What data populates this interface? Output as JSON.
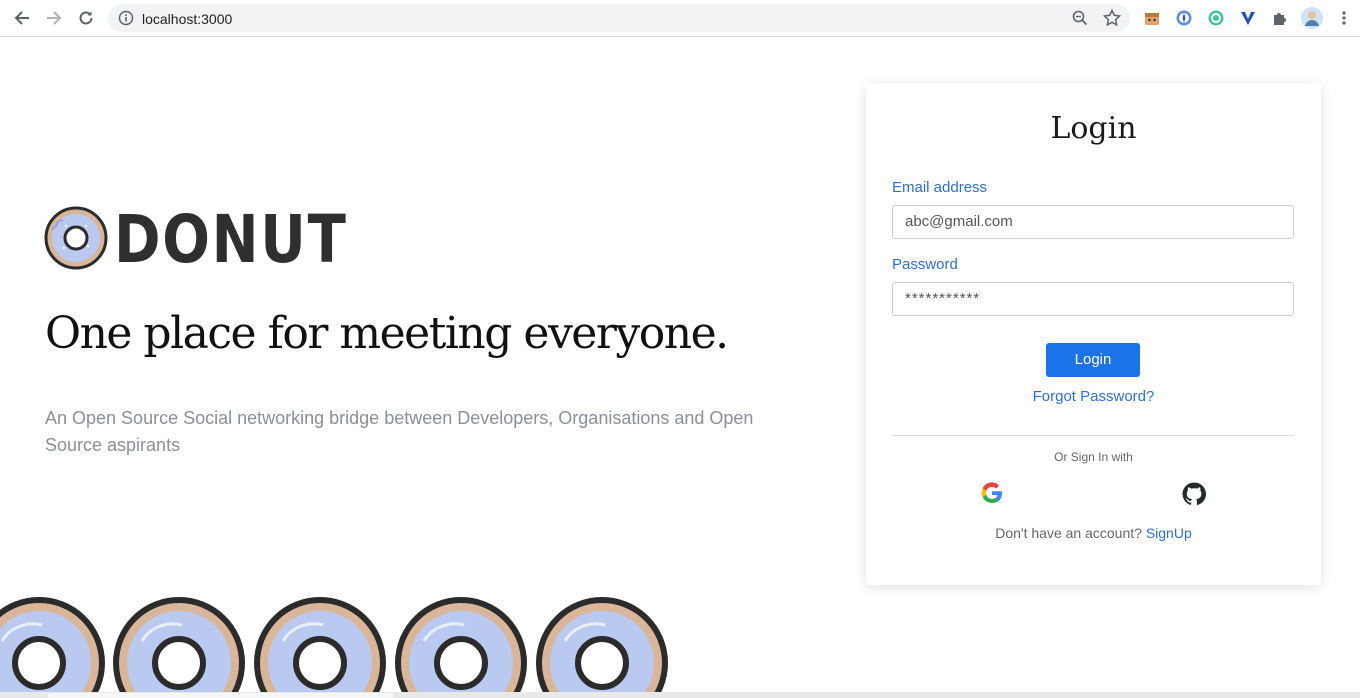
{
  "browser": {
    "url": "localhost:3000",
    "icons": [
      "back-arrow-icon",
      "forward-arrow-icon",
      "reload-icon",
      "info-icon",
      "zoom-icon",
      "star-icon",
      "extension-puzzle-icon",
      "more-vert-icon",
      "profile-avatar"
    ]
  },
  "hero": {
    "brand": "DONUT",
    "headline": "One place for meeting everyone.",
    "tagline": "An Open Source Social networking bridge between Developers, Organisations and Open Source aspirants"
  },
  "login": {
    "title": "Login",
    "email_label": "Email address",
    "email_value": "abc@gmail.com",
    "password_label": "Password",
    "password_value": "***********",
    "login_button": "Login",
    "forgot": "Forgot Password?",
    "or_text": "Or Sign In with",
    "no_account": "Don't have an account? ",
    "signup": "SignUp"
  },
  "colors": {
    "accent": "#1a73e8",
    "link": "#2f6fd1",
    "donut_glaze": "#b9c9f0",
    "donut_outline": "#2b2b2b"
  }
}
